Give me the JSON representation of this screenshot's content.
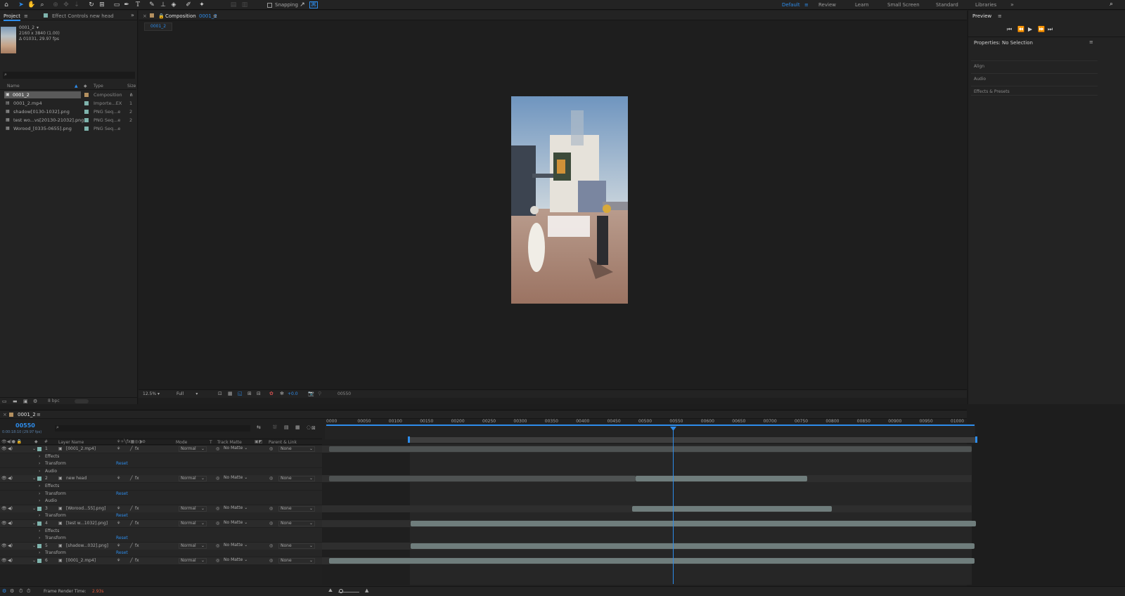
{
  "toolbar": {
    "snapping": "Snapping",
    "workspaces": [
      "Default",
      "Review",
      "Learn",
      "Small Screen",
      "Standard",
      "Libraries"
    ]
  },
  "project": {
    "tab": "Project",
    "effect_tab": "Effect Controls new head",
    "thumb_name": "0001_2",
    "thumb_res": "2160 x 3840 (1.00)",
    "thumb_dur": "Δ 01031, 29.97 fps",
    "col_name": "Name",
    "col_type": "Type",
    "col_size": "Size",
    "items": [
      {
        "name": "0001_2",
        "type": "Composition",
        "size": ""
      },
      {
        "name": "0001_2.mp4",
        "type": "Importe...EX",
        "size": "1"
      },
      {
        "name": "shadow[0130-1032].png",
        "type": "PNG Seq...e",
        "size": "2"
      },
      {
        "name": "test wo...vs[20130-21032].png",
        "type": "PNG Seq...e",
        "size": "2"
      },
      {
        "name": "Worood_[0335-0655].png",
        "type": "PNG Seq...e",
        "size": ""
      }
    ],
    "bpc": "8 bpc"
  },
  "composition": {
    "tab_prefix": "Composition",
    "tab_name": "0001_2",
    "breadcrumb": "0001_2",
    "zoom": "12.5%",
    "resolution": "Full",
    "exposure": "+0.0",
    "timecode": "00550"
  },
  "preview": {
    "tab": "Preview",
    "properties": "Properties: No Selection",
    "sections": [
      "Align",
      "Audio",
      "Effects & Presets"
    ]
  },
  "timeline": {
    "tab": "0001_2",
    "current_frame": "00550",
    "current_time": "0:00:18:10 (29.97 fps)",
    "col_layer": "Layer Name",
    "col_mode": "Mode",
    "col_t": "T",
    "col_track": "Track Matte",
    "col_parent": "Parent & Link",
    "ruler": [
      "0000",
      "00050",
      "00100",
      "00150",
      "00200",
      "00250",
      "00300",
      "00350",
      "00400",
      "00450",
      "00500",
      "00550",
      "00600",
      "00650",
      "00700",
      "00750",
      "00800",
      "00850",
      "00900",
      "00950",
      "01000"
    ],
    "rows": [
      {
        "kind": "layer",
        "num": "1",
        "name": "[0001_2.mp4]",
        "mode": "Normal",
        "matte": "No Matte",
        "parent": "None"
      },
      {
        "kind": "sub",
        "name": "Effects"
      },
      {
        "kind": "sub",
        "name": "Transform",
        "reset": "Reset"
      },
      {
        "kind": "sub",
        "name": "Audio"
      },
      {
        "kind": "layer",
        "num": "2",
        "name": "new head",
        "mode": "Normal",
        "matte": "No Matte",
        "parent": "None"
      },
      {
        "kind": "sub",
        "name": "Effects"
      },
      {
        "kind": "sub",
        "name": "Transform",
        "reset": "Reset"
      },
      {
        "kind": "sub",
        "name": "Audio"
      },
      {
        "kind": "layer",
        "num": "3",
        "name": "[Worood...55].png]",
        "mode": "Normal",
        "matte": "No Matte",
        "parent": "None"
      },
      {
        "kind": "sub",
        "name": "Transform",
        "reset": "Reset"
      },
      {
        "kind": "layer",
        "num": "4",
        "name": "[test w...1032].png]",
        "mode": "Normal",
        "matte": "No Matte",
        "parent": "None"
      },
      {
        "kind": "sub",
        "name": "Effects"
      },
      {
        "kind": "sub",
        "name": "Transform",
        "reset": "Reset"
      },
      {
        "kind": "layer",
        "num": "5",
        "name": "[shadow...032].png]",
        "mode": "Normal",
        "matte": "No Matte",
        "parent": "None"
      },
      {
        "kind": "sub",
        "name": "Transform",
        "reset": "Reset"
      },
      {
        "kind": "layer",
        "num": "6",
        "name": "[0001_2.mp4]",
        "mode": "Normal",
        "matte": "No Matte",
        "parent": "None"
      }
    ],
    "status_label": "Frame Render Time:",
    "status_value": "2.93s"
  },
  "colors": {
    "accent": "#2d8ceb",
    "composition_label": "#b49060",
    "layer_label": "#7fb4ad"
  }
}
